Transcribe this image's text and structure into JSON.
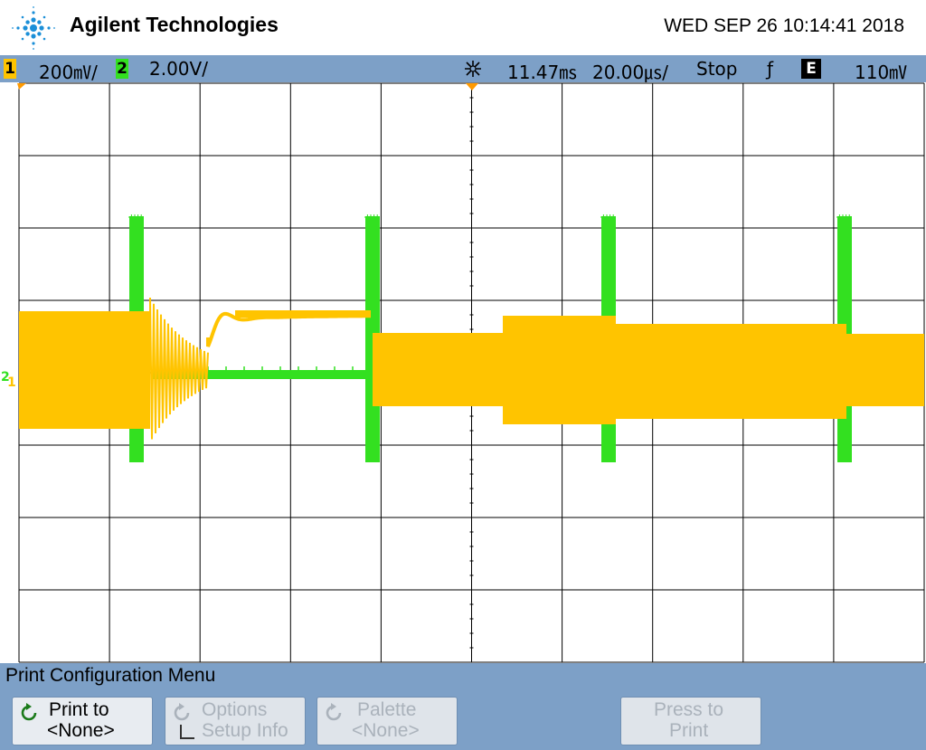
{
  "header": {
    "brand": "Agilent Technologies",
    "datetime": "WED SEP 26 10:14:41 2018"
  },
  "status": {
    "ch1_label": "1",
    "ch1_scale": "200㎷/",
    "ch2_label": "2",
    "ch2_scale": "2.00V/",
    "delay": "11.47㎳",
    "timebase": "20.00㎲/",
    "run_state": "Stop",
    "trigger_slope": "ƒ",
    "trigger_mode": "E",
    "trigger_level": "110㎷"
  },
  "colors": {
    "ch1": "#ffc400",
    "ch2": "#33e020",
    "grid": "#000000",
    "bar": "#7da0c7"
  },
  "trace_markers": {
    "ch2_ground": "2",
    "ch1_ground": "1"
  },
  "menu": {
    "title": "Print Configuration Menu",
    "keys": [
      {
        "line1": "Print to",
        "line2": "<None>",
        "enabled": true
      },
      {
        "line1": "Options",
        "line2": "Setup Info",
        "enabled": false
      },
      {
        "line1": "Palette",
        "line2": "<None>",
        "enabled": false
      },
      {
        "line1": "Press to",
        "line2": "Print",
        "enabled": false
      }
    ]
  }
}
